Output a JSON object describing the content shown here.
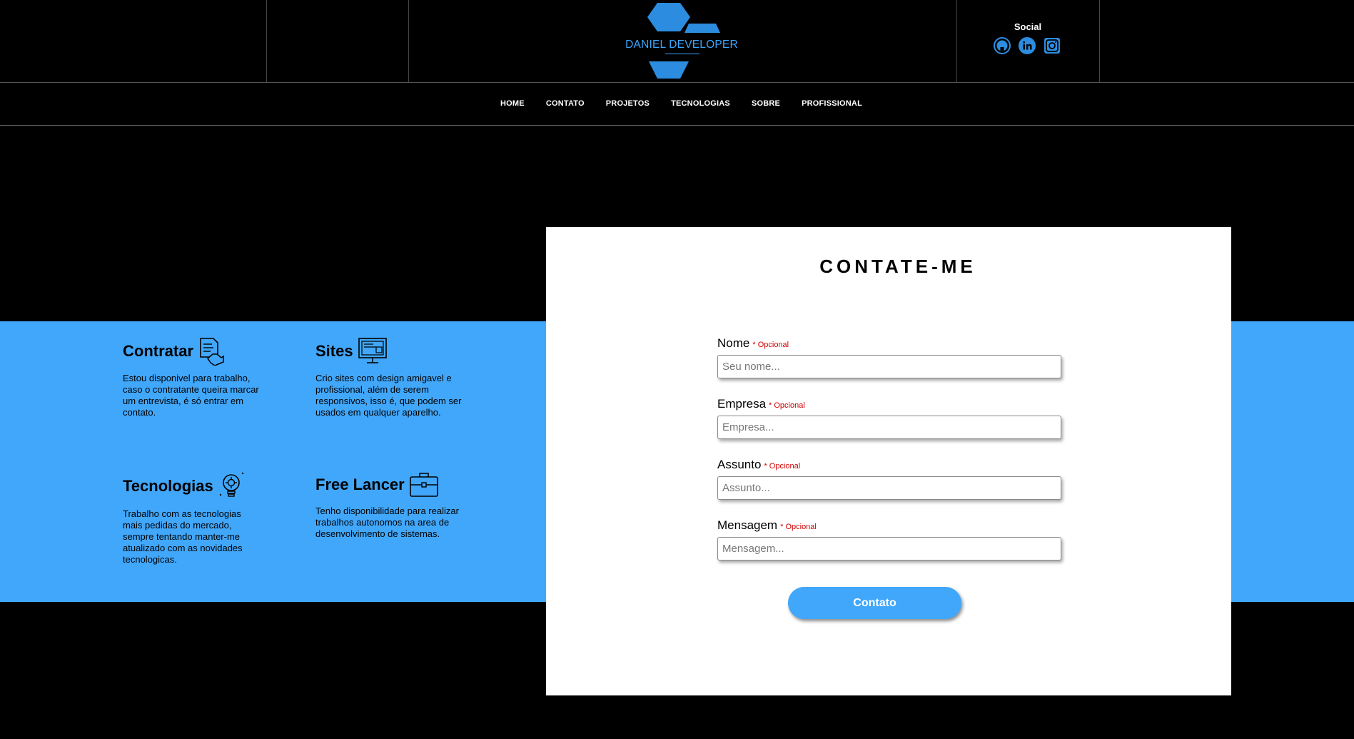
{
  "header": {
    "logo_text": "DANIEL DEVELOPER",
    "social_title": "Social",
    "social_icons": [
      "github-icon",
      "linkedin-icon",
      "instagram-icon"
    ]
  },
  "nav": {
    "items": [
      {
        "label": "HOME"
      },
      {
        "label": "CONTATO"
      },
      {
        "label": "PROJETOS"
      },
      {
        "label": "TECNOLOGIAS"
      },
      {
        "label": "SOBRE"
      },
      {
        "label": "PROFISSIONAL"
      }
    ]
  },
  "features": [
    {
      "title": "Contratar",
      "icon": "handshake-document-icon",
      "description": "Estou disponivel para trabalho, caso o contratante queira marcar um entrevista, é só entrar em contato."
    },
    {
      "title": "Sites",
      "icon": "monitor-icon",
      "description": "Crio sites com design amigavel e profissional, além de serem responsivos, isso é, que podem ser usados em qualquer aparelho."
    },
    {
      "title": "Tecnologias",
      "icon": "lightbulb-gear-icon",
      "description": "Trabalho com as tecnologias mais pedidas do mercado, sempre tentando manter-me atualizado com as novidades tecnologicas."
    },
    {
      "title": "Free Lancer",
      "icon": "briefcase-icon",
      "description": "Tenho disponibilidade para realizar trabalhos autonomos na area de desenvolvimento de sistemas."
    }
  ],
  "form": {
    "title": "CONTATE-ME",
    "fields": [
      {
        "label": "Nome",
        "required_note": "* Opcional",
        "placeholder": "Seu nome..."
      },
      {
        "label": "Empresa",
        "required_note": "* Opcional",
        "placeholder": "Empresa..."
      },
      {
        "label": "Assunto",
        "required_note": "* Opcional",
        "placeholder": "Assunto..."
      },
      {
        "label": "Mensagem",
        "required_note": "* Opcional",
        "placeholder": "Mensagem..."
      }
    ],
    "submit_label": "Contato"
  },
  "colors": {
    "accent": "#41a7fb",
    "background": "#000000",
    "card": "#ffffff",
    "required": "#d00000"
  }
}
